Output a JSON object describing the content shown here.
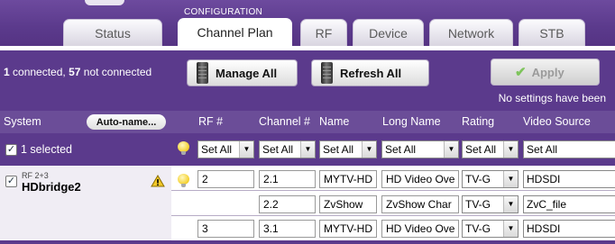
{
  "header": {
    "section_label": "CONFIGURATION",
    "tabs": [
      {
        "label": "Status"
      },
      {
        "label": "Channel Plan"
      },
      {
        "label": "RF"
      },
      {
        "label": "Device"
      },
      {
        "label": "Network"
      },
      {
        "label": "STB"
      }
    ]
  },
  "actions": {
    "connected_count": "1",
    "connected_text": " connected, ",
    "not_connected_count": "57",
    "not_connected_text": " not connected",
    "manage_all": "Manage All",
    "refresh_all": "Refresh All",
    "apply": "Apply",
    "no_settings": "No settings have been"
  },
  "columns": {
    "system": "System",
    "auto_name": "Auto-name...",
    "rf": "RF #",
    "channel": "Channel #",
    "name": "Name",
    "long_name": "Long Name",
    "rating": "Rating",
    "video_source": "Video Source"
  },
  "selection": {
    "selected_text": "1 selected",
    "set_all": "Set All"
  },
  "device": {
    "rf_label": "RF 2+3",
    "name": "HDbridge2",
    "rows": [
      {
        "rf": "2",
        "channel": "2.1",
        "name": "MYTV-HD",
        "long_name": "HD Video Ove",
        "rating": "TV-G",
        "video_source": "HDSDI"
      },
      {
        "rf": "",
        "channel": "2.2",
        "name": "ZvShow",
        "long_name": "ZvShow Char",
        "rating": "TV-G",
        "video_source": "ZvC_file"
      },
      {
        "rf": "3",
        "channel": "3.1",
        "name": "MYTV-HD",
        "long_name": "HD Video Ove",
        "rating": "TV-G",
        "video_source": "HDSDI"
      }
    ]
  }
}
